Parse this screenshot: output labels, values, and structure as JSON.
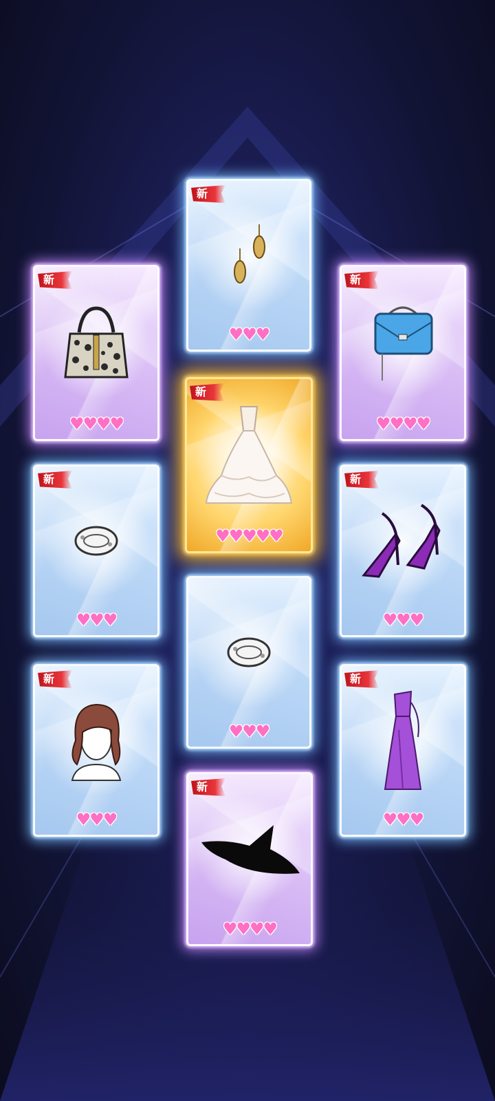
{
  "badge_text": "新",
  "cards": [
    {
      "id": "earrings",
      "rarity": "blue",
      "new": true,
      "hearts": 3,
      "item": "earrings-icon"
    },
    {
      "id": "leopard-handbag",
      "rarity": "purple",
      "new": true,
      "hearts": 4,
      "item": "handbag-icon"
    },
    {
      "id": "blue-clutch",
      "rarity": "purple",
      "new": true,
      "hearts": 4,
      "item": "clutch-bag-icon"
    },
    {
      "id": "wedding-gown",
      "rarity": "gold",
      "new": true,
      "hearts": 5,
      "item": "gown-icon"
    },
    {
      "id": "crystal-bracelet-left",
      "rarity": "blue",
      "new": true,
      "hearts": 3,
      "item": "bracelet-icon"
    },
    {
      "id": "purple-heels",
      "rarity": "blue",
      "new": true,
      "hearts": 3,
      "item": "heels-icon"
    },
    {
      "id": "crystal-bracelet-center",
      "rarity": "blue",
      "new": false,
      "hearts": 3,
      "item": "bracelet-icon"
    },
    {
      "id": "auburn-hair",
      "rarity": "blue",
      "new": true,
      "hearts": 3,
      "item": "hair-icon"
    },
    {
      "id": "purple-dress",
      "rarity": "blue",
      "new": true,
      "hearts": 3,
      "item": "dress-icon"
    },
    {
      "id": "witch-hat",
      "rarity": "purple",
      "new": true,
      "hearts": 4,
      "item": "hat-icon"
    }
  ],
  "heart_glyph": "♥"
}
